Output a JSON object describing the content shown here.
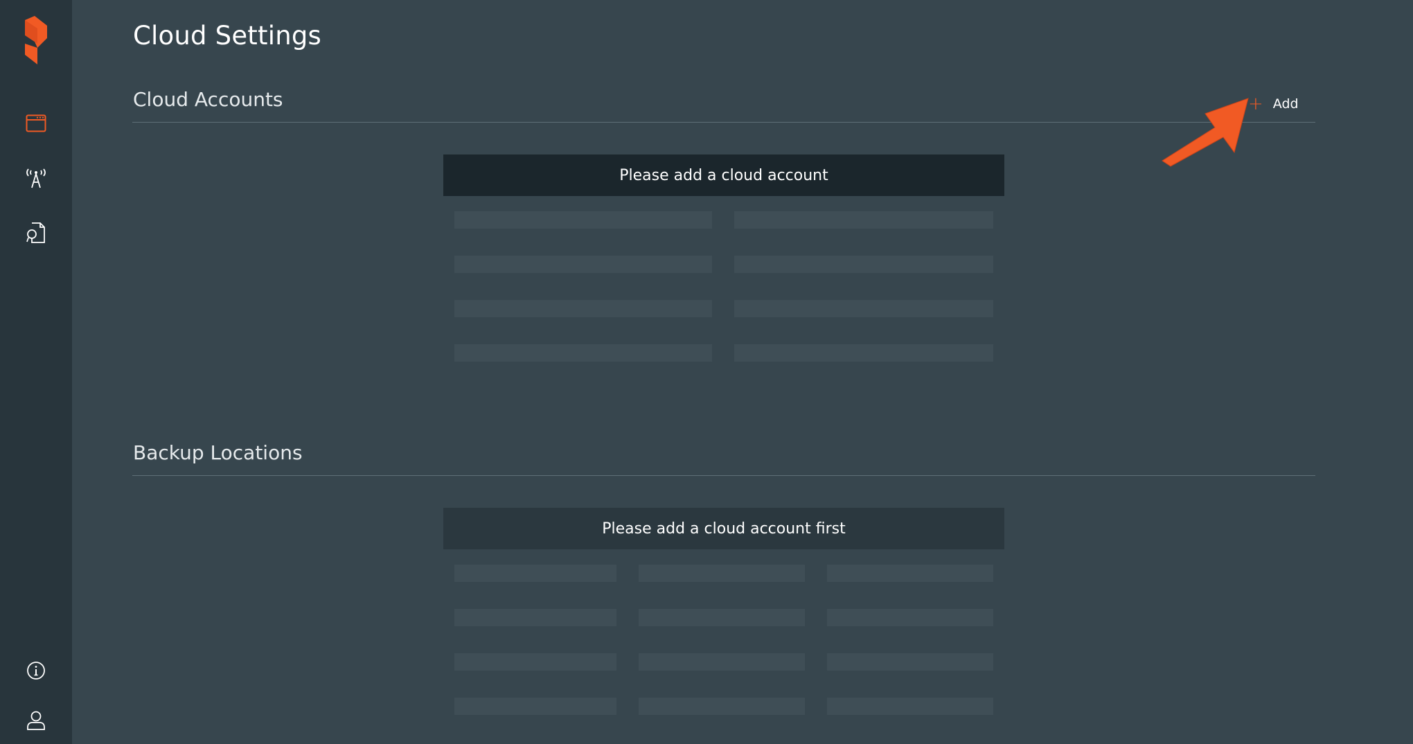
{
  "page": {
    "title": "Cloud Settings"
  },
  "sidebar": {
    "logo_icon": "portworx-logo-icon",
    "items": [
      {
        "icon": "clusters-icon",
        "active": true
      },
      {
        "icon": "antenna-icon",
        "active": false
      },
      {
        "icon": "backup-document-icon",
        "active": false
      }
    ],
    "bottom_items": [
      {
        "icon": "info-icon"
      },
      {
        "icon": "user-icon"
      }
    ]
  },
  "cloud_accounts": {
    "title": "Cloud Accounts",
    "add_icon": "+",
    "add_label": "Add",
    "empty_message": "Please add a cloud account"
  },
  "backup_locations": {
    "title": "Backup Locations",
    "empty_message": "Please add a cloud account first"
  },
  "colors": {
    "accent": "#f15a24",
    "background": "#37464e",
    "sidebar": "#28353c"
  }
}
